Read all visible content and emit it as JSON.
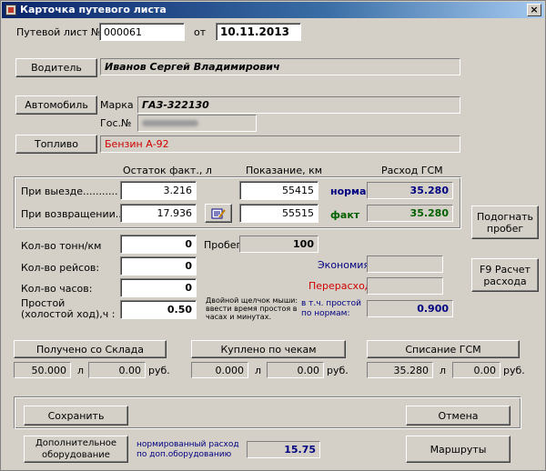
{
  "window": {
    "title": "Карточка путевого листа",
    "close": "×"
  },
  "header": {
    "waybill_label": "Путевой лист №",
    "waybill_number": "000061",
    "from_label": "от",
    "date": "10.11.2013"
  },
  "driver": {
    "button": "Водитель",
    "value": "Иванов Сергей Владимирович"
  },
  "car": {
    "button": "Автомобиль",
    "brand_label": "Марка",
    "brand_value": "ГАЗ-322130",
    "plate_label": "Гос.№"
  },
  "fuel": {
    "button": "Топливо",
    "value": "Бензин А-92",
    "value_color": "#d00000"
  },
  "columns": {
    "rest": "Остаток факт., л",
    "reading": "Показание, км",
    "consumption": "Расход ГСМ"
  },
  "departure": {
    "label": "При выезде...........",
    "rest": "3.216",
    "reading": "55415",
    "tag": "норма",
    "consumption": "35.280"
  },
  "return": {
    "label": "При возвращении....",
    "rest": "17.936",
    "reading": "55515",
    "tag": "факт",
    "consumption": "35.280"
  },
  "buttons": {
    "adjust_mileage": "Подогнать пробег",
    "calc": "F9 Расчет расхода"
  },
  "tons": {
    "label": "Кол-во тонн/км",
    "value": "0"
  },
  "mileage": {
    "label": "Пробег",
    "value": "100"
  },
  "trips": {
    "label": "Кол-во рейсов:",
    "value": "0"
  },
  "hours": {
    "label": "Кол-во часов:",
    "value": "0"
  },
  "idle": {
    "label_line1": "Простой",
    "label_line2": "(холостой ход),ч :",
    "value": "0.50"
  },
  "hint": {
    "line1": "Двойной щелчок мыши:",
    "line2": "ввести время простоя в",
    "line3": "часах и минутах."
  },
  "economy": {
    "label": "Экономия",
    "value": ""
  },
  "overspend": {
    "label": "Перерасход",
    "value": ""
  },
  "idle_norm": {
    "line1": "в т.ч. простой",
    "line2": "по нормам:",
    "value": "0.900"
  },
  "stock": {
    "button": "Получено со Склада",
    "liters": "50.000",
    "l": "л",
    "rub": "0.00",
    "rub_label": "руб."
  },
  "receipts": {
    "button": "Куплено по чекам",
    "liters": "0.000",
    "l": "л",
    "rub": "0.00",
    "rub_label": "руб."
  },
  "writeoff": {
    "button": "Списание ГСМ",
    "liters": "35.280",
    "l": "л",
    "rub": "0.00",
    "rub_label": "руб."
  },
  "footer": {
    "save": "Сохранить",
    "cancel": "Отмена",
    "extra_equipment": "Дополнительное оборудование",
    "norm_line1": "нормированный расход",
    "norm_line2": "по доп.оборудованию",
    "norm_value": "15.75",
    "routes": "Маршруты"
  },
  "colors": {
    "navy": "#000080",
    "green": "#006000",
    "red": "#d00000"
  }
}
